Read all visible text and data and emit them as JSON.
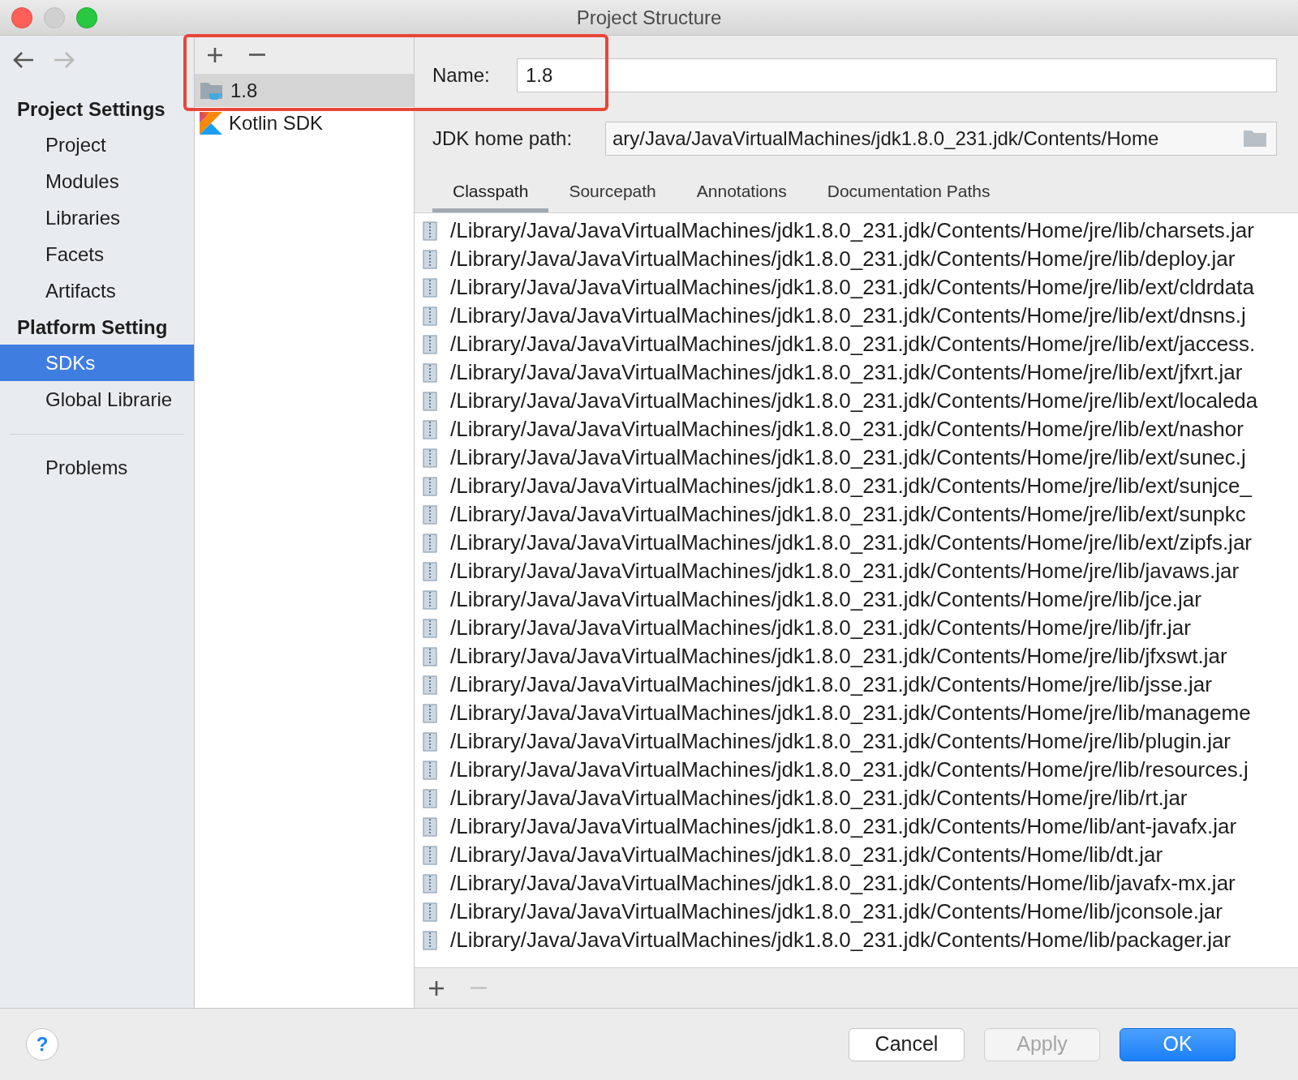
{
  "window": {
    "title": "Project Structure",
    "controls": [
      {
        "kind": "close",
        "disabled": false
      },
      {
        "kind": "minimize",
        "disabled": true
      },
      {
        "kind": "zoom",
        "disabled": false
      }
    ]
  },
  "nav_buttons": [
    {
      "kind": "back",
      "disabled": false
    },
    {
      "kind": "forward",
      "disabled": true
    }
  ],
  "sidebar": {
    "sections": [
      {
        "heading": "Project Settings",
        "items": [
          {
            "label": "Project",
            "selected": false
          },
          {
            "label": "Modules",
            "selected": false
          },
          {
            "label": "Libraries",
            "selected": false
          },
          {
            "label": "Facets",
            "selected": false
          },
          {
            "label": "Artifacts",
            "selected": false
          }
        ]
      },
      {
        "heading": "Platform Setting",
        "items": [
          {
            "label": "SDKs",
            "selected": true
          },
          {
            "label": "Global Librarie",
            "selected": false
          }
        ]
      }
    ],
    "footer_items": [
      {
        "label": "Problems",
        "selected": false
      }
    ]
  },
  "sdk_list": {
    "toolbar": [
      {
        "kind": "add",
        "disabled": false
      },
      {
        "kind": "remove",
        "disabled": false
      }
    ],
    "items": [
      {
        "label": "1.8",
        "kind": "jdk",
        "selected": true
      },
      {
        "label": "Kotlin SDK",
        "kind": "kotlin",
        "selected": false
      }
    ]
  },
  "detail": {
    "name": {
      "label": "Name:",
      "value": "1.8"
    },
    "home_path": {
      "label": "JDK home path:",
      "value": "ary/Java/JavaVirtualMachines/jdk1.8.0_231.jdk/Contents/Home"
    },
    "tabs": [
      {
        "label": "Classpath",
        "selected": true
      },
      {
        "label": "Sourcepath",
        "selected": false
      },
      {
        "label": "Annotations",
        "selected": false
      },
      {
        "label": "Documentation Paths",
        "selected": false
      }
    ],
    "paths": [
      "/Library/Java/JavaVirtualMachines/jdk1.8.0_231.jdk/Contents/Home/jre/lib/charsets.jar",
      "/Library/Java/JavaVirtualMachines/jdk1.8.0_231.jdk/Contents/Home/jre/lib/deploy.jar",
      "/Library/Java/JavaVirtualMachines/jdk1.8.0_231.jdk/Contents/Home/jre/lib/ext/cldrdata",
      "/Library/Java/JavaVirtualMachines/jdk1.8.0_231.jdk/Contents/Home/jre/lib/ext/dnsns.j",
      "/Library/Java/JavaVirtualMachines/jdk1.8.0_231.jdk/Contents/Home/jre/lib/ext/jaccess.",
      "/Library/Java/JavaVirtualMachines/jdk1.8.0_231.jdk/Contents/Home/jre/lib/ext/jfxrt.jar",
      "/Library/Java/JavaVirtualMachines/jdk1.8.0_231.jdk/Contents/Home/jre/lib/ext/localeda",
      "/Library/Java/JavaVirtualMachines/jdk1.8.0_231.jdk/Contents/Home/jre/lib/ext/nashor",
      "/Library/Java/JavaVirtualMachines/jdk1.8.0_231.jdk/Contents/Home/jre/lib/ext/sunec.j",
      "/Library/Java/JavaVirtualMachines/jdk1.8.0_231.jdk/Contents/Home/jre/lib/ext/sunjce_",
      "/Library/Java/JavaVirtualMachines/jdk1.8.0_231.jdk/Contents/Home/jre/lib/ext/sunpkc",
      "/Library/Java/JavaVirtualMachines/jdk1.8.0_231.jdk/Contents/Home/jre/lib/ext/zipfs.jar",
      "/Library/Java/JavaVirtualMachines/jdk1.8.0_231.jdk/Contents/Home/jre/lib/javaws.jar",
      "/Library/Java/JavaVirtualMachines/jdk1.8.0_231.jdk/Contents/Home/jre/lib/jce.jar",
      "/Library/Java/JavaVirtualMachines/jdk1.8.0_231.jdk/Contents/Home/jre/lib/jfr.jar",
      "/Library/Java/JavaVirtualMachines/jdk1.8.0_231.jdk/Contents/Home/jre/lib/jfxswt.jar",
      "/Library/Java/JavaVirtualMachines/jdk1.8.0_231.jdk/Contents/Home/jre/lib/jsse.jar",
      "/Library/Java/JavaVirtualMachines/jdk1.8.0_231.jdk/Contents/Home/jre/lib/manageme",
      "/Library/Java/JavaVirtualMachines/jdk1.8.0_231.jdk/Contents/Home/jre/lib/plugin.jar",
      "/Library/Java/JavaVirtualMachines/jdk1.8.0_231.jdk/Contents/Home/jre/lib/resources.j",
      "/Library/Java/JavaVirtualMachines/jdk1.8.0_231.jdk/Contents/Home/jre/lib/rt.jar",
      "/Library/Java/JavaVirtualMachines/jdk1.8.0_231.jdk/Contents/Home/lib/ant-javafx.jar",
      "/Library/Java/JavaVirtualMachines/jdk1.8.0_231.jdk/Contents/Home/lib/dt.jar",
      "/Library/Java/JavaVirtualMachines/jdk1.8.0_231.jdk/Contents/Home/lib/javafx-mx.jar",
      "/Library/Java/JavaVirtualMachines/jdk1.8.0_231.jdk/Contents/Home/lib/jconsole.jar",
      "/Library/Java/JavaVirtualMachines/jdk1.8.0_231.jdk/Contents/Home/lib/packager.jar"
    ],
    "list_toolbar": [
      {
        "kind": "add",
        "disabled": false
      },
      {
        "kind": "remove",
        "disabled": true
      }
    ]
  },
  "footer": {
    "help": "?",
    "buttons": [
      {
        "label": "Cancel",
        "kind": "normal",
        "disabled": false
      },
      {
        "label": "Apply",
        "kind": "normal",
        "disabled": true
      },
      {
        "label": "OK",
        "kind": "default",
        "disabled": false
      }
    ]
  }
}
